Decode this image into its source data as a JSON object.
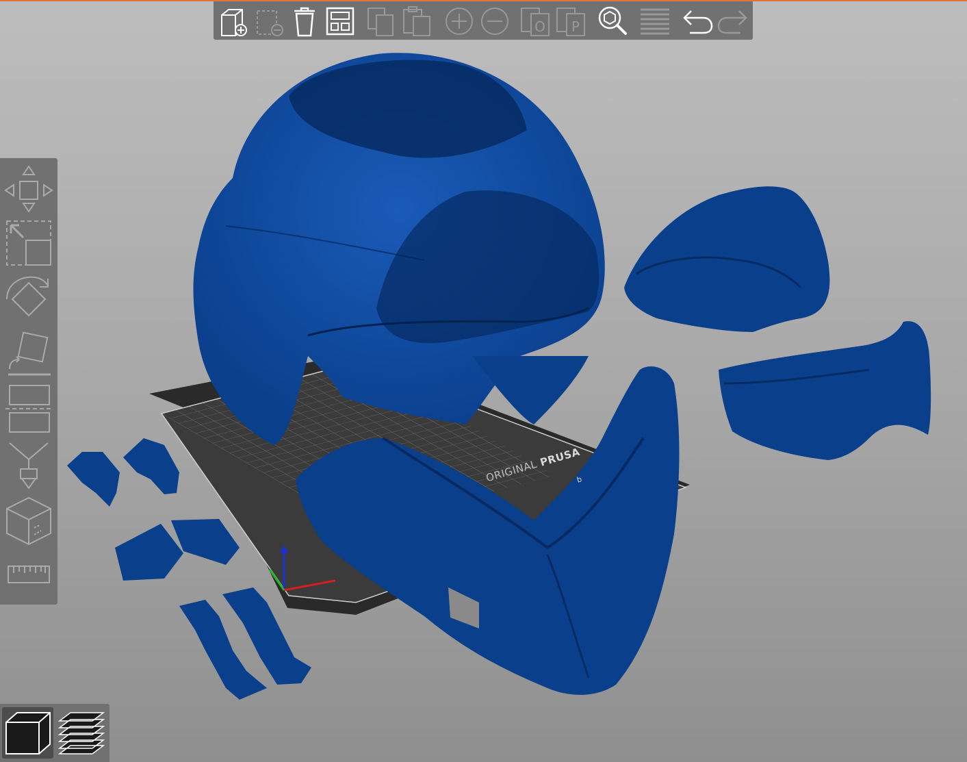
{
  "bed": {
    "brand_prefix": "ORIGINAL",
    "brand_name": "PRUSA",
    "sub_text": "b"
  },
  "colors": {
    "model": "#0a3f8c",
    "model_dark": "#062b63",
    "model_light": "#1a5bb8",
    "toolbar_bg": "#717171",
    "accent": "#e0743a"
  },
  "top_toolbar": {
    "buttons": [
      {
        "name": "add-icon",
        "enabled": true
      },
      {
        "name": "delete-icon",
        "enabled": false
      },
      {
        "name": "delete-all-icon",
        "enabled": true
      },
      {
        "name": "arrange-icon",
        "enabled": true
      },
      {
        "name": "copy-icon",
        "enabled": false
      },
      {
        "name": "paste-icon",
        "enabled": false
      },
      {
        "name": "add-instance-icon",
        "enabled": false
      },
      {
        "name": "remove-instance-icon",
        "enabled": false
      },
      {
        "name": "split-to-objects-icon",
        "enabled": false
      },
      {
        "name": "split-to-parts-icon",
        "enabled": false
      },
      {
        "name": "search-icon",
        "enabled": true
      },
      {
        "name": "layers-editing-icon",
        "enabled": false
      },
      {
        "name": "undo-icon",
        "enabled": true
      },
      {
        "name": "redo-icon",
        "enabled": false
      }
    ]
  },
  "left_toolbar": {
    "tools": [
      "move-icon",
      "scale-icon",
      "rotate-icon",
      "place-on-face-icon",
      "cut-icon",
      "paint-supports-icon",
      "seam-painting-icon",
      "measure-icon"
    ]
  },
  "view_toolbar": {
    "views": [
      "3d-view-icon",
      "preview-icon"
    ],
    "active": "3d-view-icon"
  }
}
